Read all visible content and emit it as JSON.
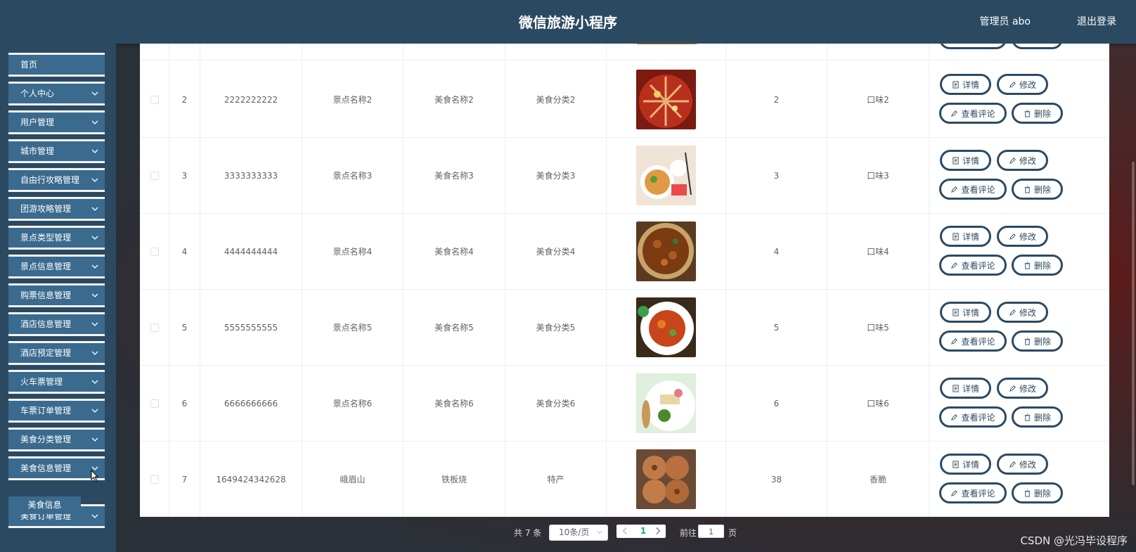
{
  "app": {
    "title": "微信旅游小程序",
    "user": "管理员 abo",
    "logout": "退出登录"
  },
  "sidebar": {
    "items": [
      {
        "label": "首页",
        "chevron": false
      },
      {
        "label": "个人中心",
        "chevron": true
      },
      {
        "label": "用户管理",
        "chevron": true
      },
      {
        "label": "城市管理",
        "chevron": true
      },
      {
        "label": "自由行攻略管理",
        "chevron": true
      },
      {
        "label": "团游攻略管理",
        "chevron": true
      },
      {
        "label": "景点类型管理",
        "chevron": true
      },
      {
        "label": "景点信息管理",
        "chevron": true
      },
      {
        "label": "购票信息管理",
        "chevron": true
      },
      {
        "label": "酒店信息管理",
        "chevron": true
      },
      {
        "label": "酒店预定管理",
        "chevron": true
      },
      {
        "label": "火车票管理",
        "chevron": true
      },
      {
        "label": "车票订单管理",
        "chevron": true
      },
      {
        "label": "美食分类管理",
        "chevron": true
      },
      {
        "label": "美食信息管理",
        "chevron": true
      },
      {
        "label": "美食订单管理",
        "chevron": true
      }
    ],
    "submenu": {
      "label": "美食信息"
    }
  },
  "table": {
    "actions": {
      "detail": "详情",
      "edit": "修改",
      "comments": "查看评论",
      "delete": "删除"
    },
    "rows": [
      {
        "index": "2",
        "code": "2222222222",
        "spot": "景点名称2",
        "food": "美食名称2",
        "category": "美食分类2",
        "image": "hotpot",
        "price": "2",
        "taste": "口味2"
      },
      {
        "index": "3",
        "code": "3333333333",
        "spot": "景点名称3",
        "food": "美食名称3",
        "category": "美食分类3",
        "image": "noodle-bowl",
        "price": "3",
        "taste": "口味3"
      },
      {
        "index": "4",
        "code": "4444444444",
        "spot": "景点名称4",
        "food": "美食名称4",
        "category": "美食分类4",
        "image": "fried-dish",
        "price": "4",
        "taste": "口味4"
      },
      {
        "index": "5",
        "code": "5555555555",
        "spot": "景点名称5",
        "food": "美食名称5",
        "category": "美食分类5",
        "image": "stir-fry-plate",
        "price": "5",
        "taste": "口味5"
      },
      {
        "index": "6",
        "code": "6666666666",
        "spot": "景点名称6",
        "food": "美食名称6",
        "category": "美食分类6",
        "image": "salad-plate",
        "price": "6",
        "taste": "口味6"
      },
      {
        "index": "7",
        "code": "1649424342628",
        "spot": "峨眉山",
        "food": "铁板烧",
        "category": "特产",
        "image": "pancakes",
        "price": "38",
        "taste": "香脆"
      }
    ]
  },
  "pagination": {
    "total": "共 7 条",
    "page_size": "10条/页",
    "current": "1",
    "goto_label": "前往",
    "goto_value": "1",
    "page_unit": "页"
  },
  "watermark": "CSDN @光冯毕设程序",
  "colors": {
    "primary": "#2b4a62",
    "menu": "#3a6a8d",
    "active_page": "#1fa57d"
  }
}
